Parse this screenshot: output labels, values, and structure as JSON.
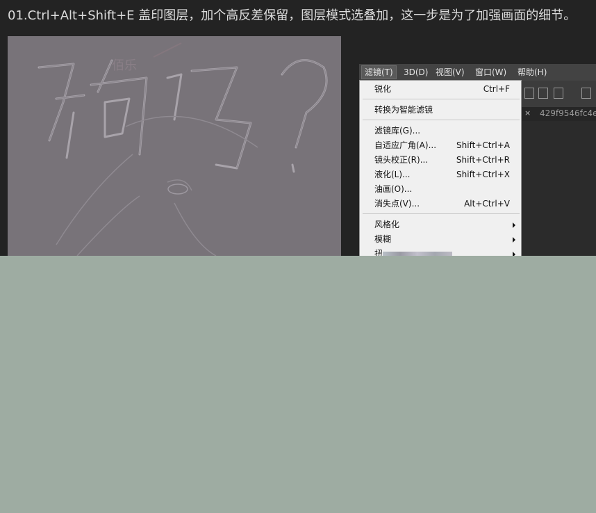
{
  "caption": "01.Ctrl+Alt+Shift+E 盖印图层，加个高反差保留，图层模式选叠加，这一步是为了加强画面的细节。",
  "menubar": [
    {
      "label": "滤镜(T)",
      "active": true
    },
    {
      "label": "3D(D)"
    },
    {
      "label": "视图(V)"
    },
    {
      "label": "窗口(W)"
    },
    {
      "label": "帮助(H)"
    }
  ],
  "document_tab": {
    "close": "×",
    "name": "429f9546fc4e"
  },
  "filter_menu": [
    {
      "label": "锐化",
      "shortcut": "Ctrl+F"
    },
    {
      "separator": true
    },
    {
      "label": "转换为智能滤镜"
    },
    {
      "separator": true
    },
    {
      "label": "滤镜库(G)..."
    },
    {
      "label": "自适应广角(A)...",
      "shortcut": "Shift+Ctrl+A"
    },
    {
      "label": "镜头校正(R)...",
      "shortcut": "Shift+Ctrl+R"
    },
    {
      "label": "液化(L)...",
      "shortcut": "Shift+Ctrl+X"
    },
    {
      "label": "油画(O)..."
    },
    {
      "label": "消失点(V)...",
      "shortcut": "Alt+Ctrl+V"
    },
    {
      "separator": true
    },
    {
      "label": "风格化",
      "submenu": true
    },
    {
      "label": "模糊",
      "submenu": true
    },
    {
      "label": "扭",
      "submenu": true
    }
  ],
  "colors": {
    "background": "#9eaca2",
    "dark_area": "#232323",
    "canvas_gray": "#787379",
    "menu_bg": "#f0f0f0",
    "menubar_bg": "#434343"
  },
  "icons": [
    "align-left-icon",
    "align-center-icon",
    "align-right-icon",
    "distribute-icon"
  ]
}
